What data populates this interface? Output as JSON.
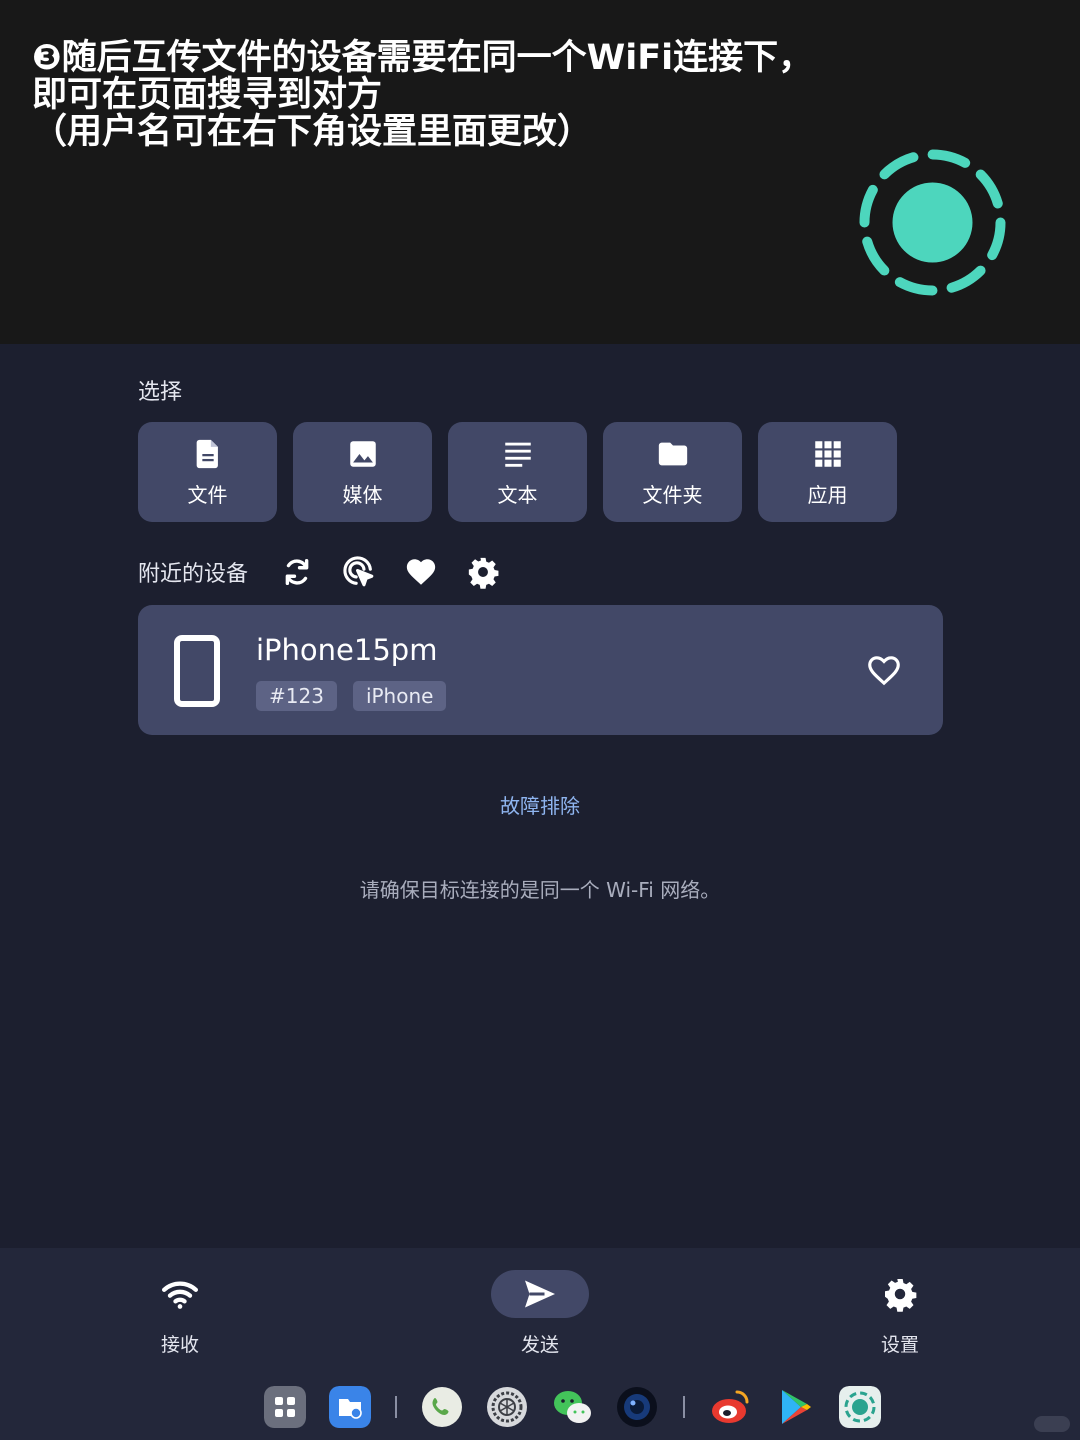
{
  "caption": {
    "line1": "❸随后互传文件的设备需要在同一个WiFi连接下，",
    "line2": "即可在页面搜寻到对方",
    "line3": "（用户名可在右下角设置里面更改）"
  },
  "colors": {
    "accent": "#4dd6bd",
    "card": "#424867",
    "background": "#1c1f2f",
    "link": "#8fb5f0"
  },
  "select": {
    "label": "选择",
    "types": [
      {
        "label": "文件",
        "icon": "file-icon"
      },
      {
        "label": "媒体",
        "icon": "image-icon"
      },
      {
        "label": "文本",
        "icon": "text-icon"
      },
      {
        "label": "文件夹",
        "icon": "folder-icon"
      },
      {
        "label": "应用",
        "icon": "apps-grid-icon"
      }
    ]
  },
  "nearby": {
    "label": "附近的设备",
    "tools": [
      "refresh-icon",
      "scan-target-icon",
      "favorites-icon",
      "settings-gear-icon"
    ]
  },
  "device": {
    "name": "iPhone15pm",
    "tags": [
      "#123",
      "iPhone"
    ],
    "icon": "phone-icon"
  },
  "troubleshoot": "故障排除",
  "hint": "请确保目标连接的是同一个 Wi-Fi 网络。",
  "nav": {
    "receive": "接收",
    "send": "发送",
    "settings": "设置"
  },
  "dock": {
    "apps": [
      "app-drawer-icon",
      "file-manager-icon",
      "phone-call-icon",
      "settings-wheel-icon",
      "wechat-icon",
      "camera-icon",
      "weibo-icon",
      "play-store-icon",
      "localsend-icon"
    ]
  }
}
